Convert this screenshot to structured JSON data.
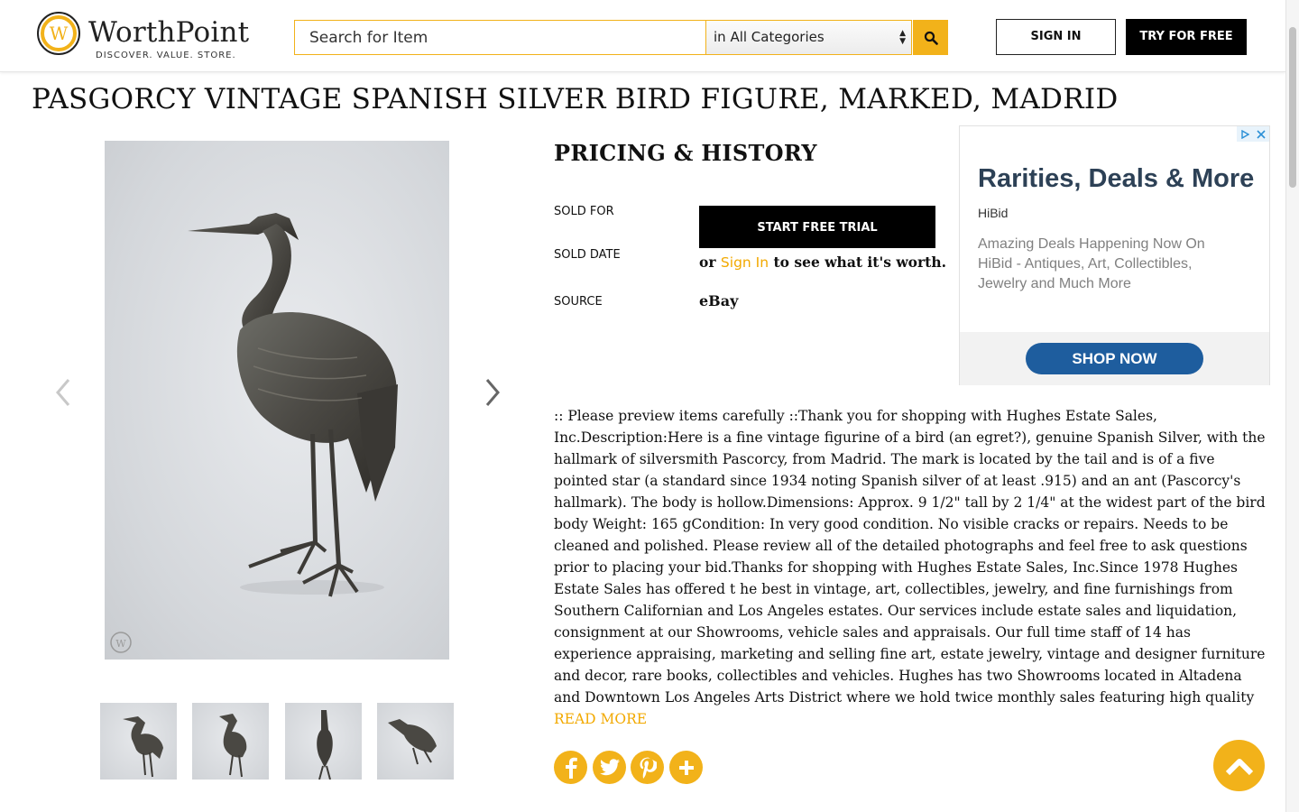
{
  "header": {
    "logo_name": "WorthPoint",
    "logo_tagline": "DISCOVER. VALUE. STORE.",
    "search_placeholder": "Search for Item",
    "category_selected": "in All Categories",
    "signin_label": "SIGN IN",
    "try_label": "TRY FOR FREE"
  },
  "item": {
    "title": "PASGORCY VINTAGE SPANISH SILVER BIRD FIGURE, MARKED, MADRID"
  },
  "pricing": {
    "heading": "PRICING & HISTORY",
    "sold_for_label": "SOLD FOR",
    "sold_date_label": "SOLD DATE",
    "source_label": "SOURCE",
    "trial_button": "START FREE TRIAL",
    "or_text": "or",
    "signin_link": "Sign In",
    "see_worth_text": "to see what it's worth.",
    "source_value": "eBay"
  },
  "ad": {
    "headline": "Rarities, Deals & More",
    "brand": "HiBid",
    "body": "Amazing Deals Happening Now On HiBid - Antiques, Art, Collectibles, Jewelry and Much More",
    "cta": "SHOP NOW"
  },
  "description": {
    "text": ":: Please preview items carefully ::Thank you for shopping with Hughes Estate Sales, Inc.Description:Here is a fine vintage figurine of a bird (an egret?), genuine Spanish Silver, with the hallmark of silversmith Pascorcy, from Madrid. The mark is located by the tail and is of a five pointed star (a standard since 1934 noting Spanish silver of at least .915) and an ant (Pascorcy's hallmark). The body is hollow.Dimensions: Approx. 9 1/2\" tall by 2 1/4\" at the widest part of the bird body Weight: 165 gCondition: In very good condition. No visible cracks or repairs. Needs to be cleaned and polished. Please review all of the detailed photographs and feel free to ask questions prior to placing your bid.Thanks for shopping with Hughes Estate Sales, Inc.Since 1978 Hughes Estate Sales has offered t he best in vintage, art, collectibles, jewelry, and fine furnishings from Southern Californian and Los Angeles estates. Our services include estate sales and liquidation, consignment at our Showrooms, vehicle sales and appraisals. Our full time staff of 14 has experience appraising, marketing and selling fine art, estate jewelry, vintage and designer furniture and decor, rare books, collectibles and vehicles. Hughes has two Showrooms located in Altadena and Downtown Los Angeles Arts District where we hold twice monthly sales featuring high quality",
    "read_more": "READ MORE"
  },
  "social": [
    "facebook-icon",
    "twitter-icon",
    "pinterest-icon",
    "plus-icon"
  ],
  "colors": {
    "accent": "#f2b21a",
    "link": "#f2a900",
    "ad_button": "#1e5d9e",
    "ad_headline": "#2d4156"
  }
}
